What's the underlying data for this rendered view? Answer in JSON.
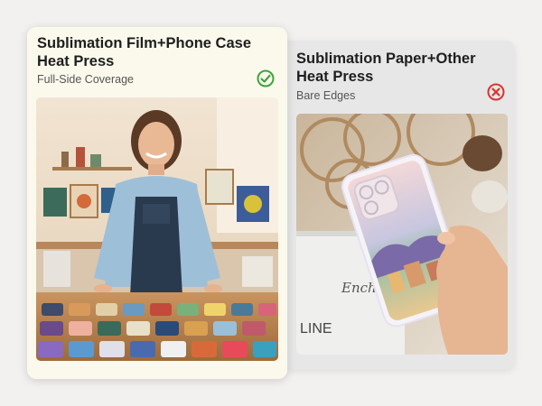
{
  "cards": [
    {
      "title": "Sublimation Film+Phone Case Heat Press",
      "subtitle": "Full-Side Coverage",
      "status_icon": "check-circle-icon",
      "status_color": "#3aa53a",
      "image_description": ""
    },
    {
      "title": "Sublimation Paper+Other Heat Press",
      "subtitle": "Bare Edges",
      "status_icon": "x-circle-icon",
      "status_color": "#d9352c",
      "box_text_1": "Enchan",
      "box_text_2": "LINE"
    }
  ]
}
